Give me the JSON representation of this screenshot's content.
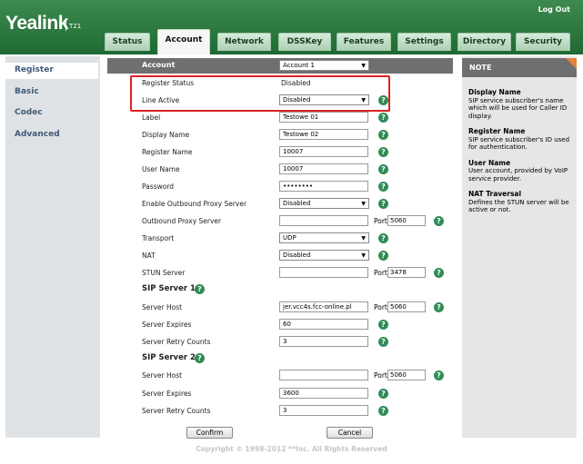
{
  "header": {
    "logo": "Yealink",
    "model": "T21",
    "logout": "Log Out",
    "tabs": [
      "Status",
      "Account",
      "Network",
      "DSSKey",
      "Features",
      "Settings",
      "Directory",
      "Security"
    ],
    "active_tab": "Account"
  },
  "sidebar": {
    "items": [
      "Register",
      "Basic",
      "Codec",
      "Advanced"
    ],
    "active": "Register"
  },
  "form": {
    "account_label": "Account",
    "account_value": "Account 1",
    "register_status_label": "Register Status",
    "register_status_value": "Disabled",
    "line_active_label": "Line Active",
    "line_active_value": "Disabled",
    "label_label": "Label",
    "label_value": "Testowe 01",
    "display_name_label": "Display Name",
    "display_name_value": "Testowe 02",
    "register_name_label": "Register Name",
    "register_name_value": "10007",
    "user_name_label": "User Name",
    "user_name_value": "10007",
    "password_label": "Password",
    "password_value": "••••••••",
    "outbound_proxy_enable_label": "Enable Outbound Proxy Server",
    "outbound_proxy_enable_value": "Disabled",
    "outbound_proxy_label": "Outbound Proxy Server",
    "outbound_proxy_value": "",
    "outbound_proxy_port": "5060",
    "transport_label": "Transport",
    "transport_value": "UDP",
    "nat_label": "NAT",
    "nat_value": "Disabled",
    "stun_label": "STUN Server",
    "stun_value": "",
    "stun_port": "3478",
    "port_label": "Port",
    "sip1_title": "SIP Server 1",
    "sip1_host_label": "Server Host",
    "sip1_host_value": "jer.vcc4s.fcc-online.pl",
    "sip1_port": "5060",
    "sip1_expires_label": "Server Expires",
    "sip1_expires_value": "60",
    "sip1_retry_label": "Server Retry Counts",
    "sip1_retry_value": "3",
    "sip2_title": "SIP Server 2",
    "sip2_host_label": "Server Host",
    "sip2_host_value": "",
    "sip2_port": "5060",
    "sip2_expires_label": "Server Expires",
    "sip2_expires_value": "3600",
    "sip2_retry_label": "Server Retry Counts",
    "sip2_retry_value": "3",
    "confirm": "Confirm",
    "cancel": "Cancel",
    "help_glyph": "?"
  },
  "note": {
    "title": "NOTE",
    "items": [
      {
        "title": "Display Name",
        "text": "SIP service subscriber's name which will be used for Caller ID display."
      },
      {
        "title": "Register Name",
        "text": "SIP service subscriber's ID used for authentication."
      },
      {
        "title": "User Name",
        "text": "User account, provided by VoIP service provider."
      },
      {
        "title": "NAT Traversal",
        "text": "Defines the STUN server will be active or not."
      }
    ]
  },
  "footer": {
    "copyright": "Copyright © 1998-2012 **Inc. All Rights Reserved"
  },
  "colors": {
    "header_green": "#2a7a40",
    "highlight_red": "#dd2222",
    "help_green": "#2f8c55"
  }
}
